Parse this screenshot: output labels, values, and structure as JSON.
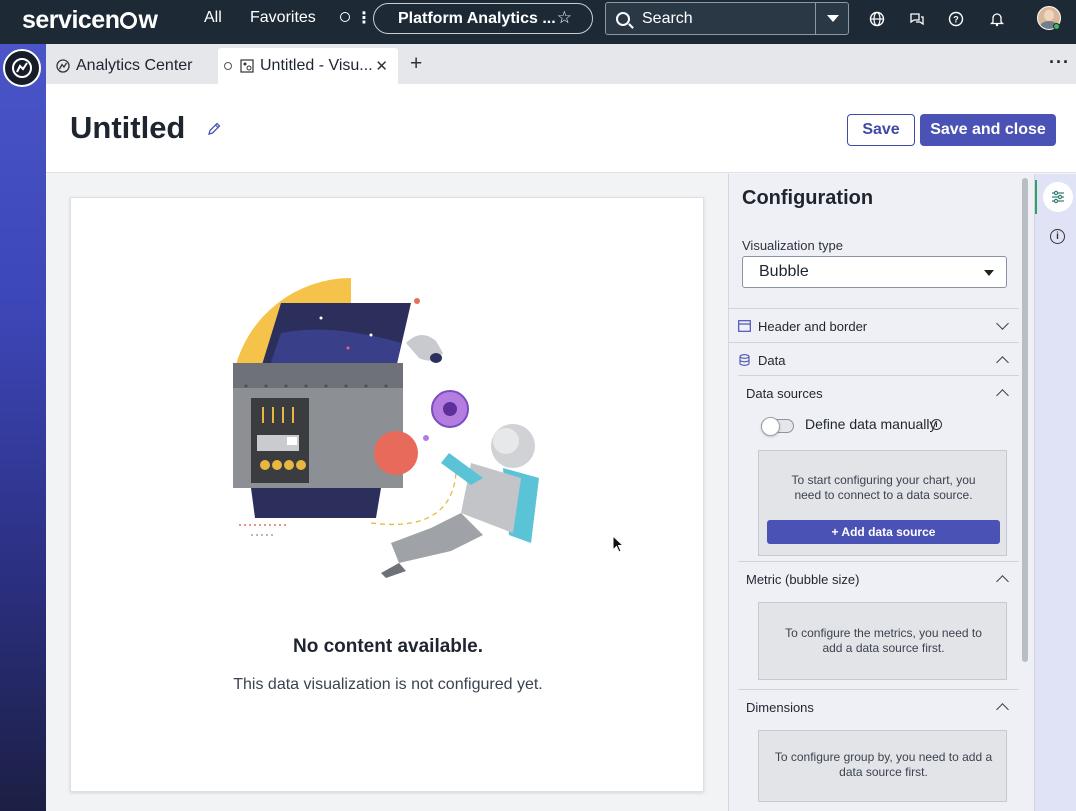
{
  "topnav": {
    "brand_prefix": "servicen",
    "brand_suffix": "w",
    "all": "All",
    "favorites": "Favorites",
    "context_pill": "Platform Analytics ...",
    "search_label": "Search"
  },
  "tabs": [
    {
      "label": "Analytics Center"
    },
    {
      "label": "Untitled - Visu..."
    }
  ],
  "header": {
    "title": "Untitled",
    "save": "Save",
    "save_and_close": "Save and close"
  },
  "canvas": {
    "empty_title": "No content available.",
    "empty_subtitle": "This data visualization is not configured yet."
  },
  "config": {
    "title": "Configuration",
    "visualization_type_label": "Visualization type",
    "visualization_type_value": "Bubble",
    "header_border": "Header and border",
    "data": "Data",
    "data_sources": "Data sources",
    "define_manually": "Define data manually",
    "connect_msg": "To start configuring your chart, you need to connect to a data source.",
    "add_source": "+ Add data source",
    "metric": "Metric (bubble size)",
    "metric_msg": "To configure the metrics, you need to add a data source first.",
    "dimensions": "Dimensions",
    "dimensions_msg": "To configure group by, you need to add a data source first."
  },
  "colors": {
    "accent": "#4b52b5",
    "nav_bg": "#1d2a36",
    "rail_top": "#4a55c7"
  }
}
